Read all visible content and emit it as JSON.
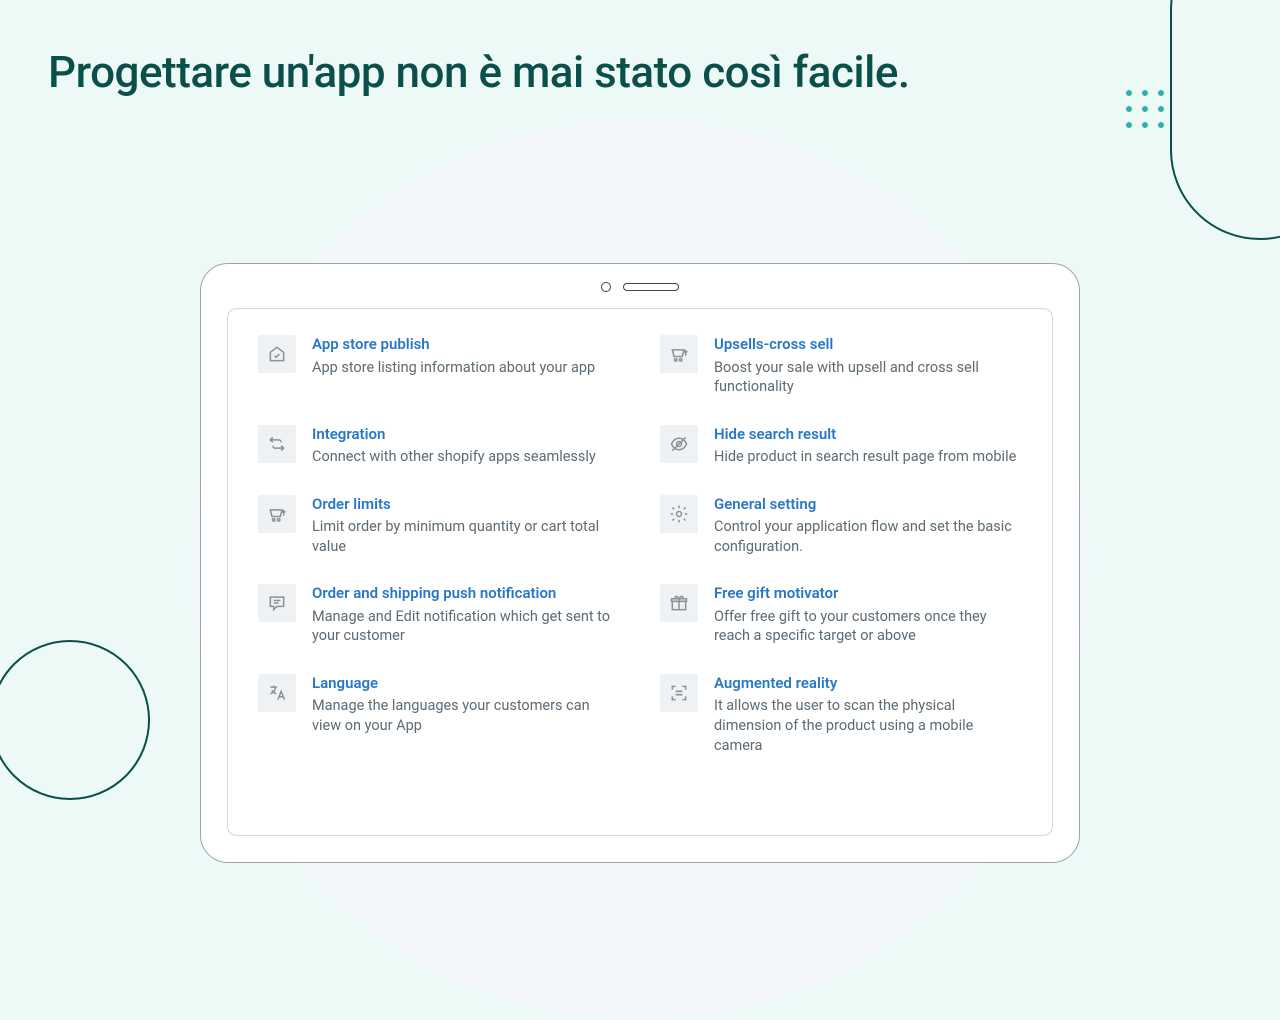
{
  "heading": "Progettare un'app non è mai stato così facile.",
  "features": {
    "left": [
      {
        "title": "App store publish",
        "desc": "App store listing information about your app",
        "icon": "home-check-icon"
      },
      {
        "title": "Integration",
        "desc": "Connect with other shopify apps seamlessly",
        "icon": "arrows-icon"
      },
      {
        "title": "Order limits",
        "desc": "Limit order by minimum quantity or cart total value",
        "icon": "cart-up-icon"
      },
      {
        "title": "Order and shipping push notification",
        "desc": "Manage and Edit notification which get sent to your customer",
        "icon": "message-icon"
      },
      {
        "title": "Language",
        "desc": "Manage the languages your customers can view on your App",
        "icon": "translate-icon"
      }
    ],
    "right": [
      {
        "title": "Upsells-cross sell",
        "desc": "Boost your sale with upsell and cross sell functionality",
        "icon": "cart-up-icon"
      },
      {
        "title": "Hide search result",
        "desc": "Hide product in search result page from mobile",
        "icon": "eye-off-icon"
      },
      {
        "title": "General setting",
        "desc": "Control your application flow and set the basic configuration.",
        "icon": "gear-icon"
      },
      {
        "title": "Free gift motivator",
        "desc": "Offer free gift to your customers once they reach a specific target or above",
        "icon": "gift-icon"
      },
      {
        "title": "Augmented reality",
        "desc": "It allows the user to scan the physical dimension of the product using a mobile camera",
        "icon": "scan-icon"
      }
    ]
  }
}
